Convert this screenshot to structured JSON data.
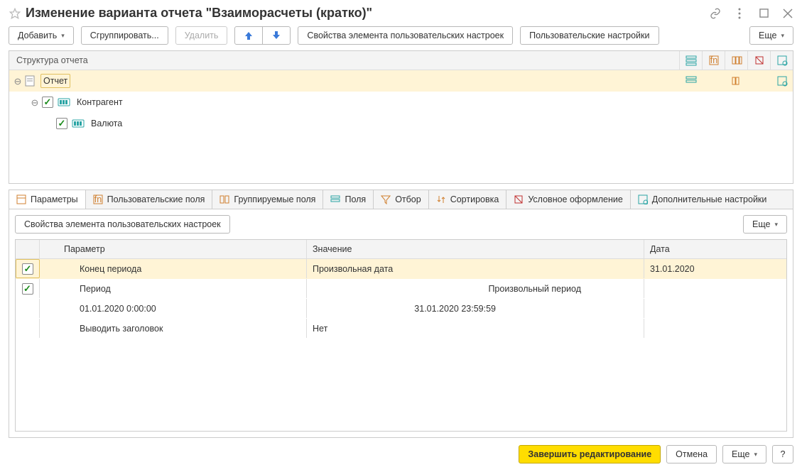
{
  "title": "Изменение варианта отчета \"Взаиморасчеты (кратко)\"",
  "toolbar": {
    "add": "Добавить",
    "group": "Сгруппировать...",
    "delete": "Удалить",
    "user_settings_props": "Свойства элемента пользовательских настроек",
    "user_settings": "Пользовательские настройки",
    "more": "Еще"
  },
  "structure": {
    "header": "Структура отчета",
    "root": "Отчет",
    "level1": "Контрагент",
    "level2": "Валюта"
  },
  "tabs": {
    "parameters": "Параметры",
    "user_fields": "Пользовательские поля",
    "group_fields": "Группируемые поля",
    "fields": "Поля",
    "filter": "Отбор",
    "sort": "Сортировка",
    "conditional": "Условное оформление",
    "extra": "Дополнительные настройки"
  },
  "param_toolbar": {
    "user_settings_props": "Свойства элемента пользовательских настроек",
    "more": "Еще"
  },
  "grid": {
    "col_param": "Параметр",
    "col_value": "Значение",
    "col_date": "Дата",
    "rows": [
      {
        "checked": true,
        "param": "Конец периода",
        "value": "Произвольная дата",
        "date": "31.01.2020"
      },
      {
        "checked": true,
        "param": "Период",
        "value_center": "Произвольный период",
        "date": ""
      },
      {
        "checked": null,
        "param": "01.01.2020 0:00:00",
        "value_right": "31.01.2020 23:59:59",
        "date": ""
      },
      {
        "checked": null,
        "param": "Выводить заголовок",
        "value": "Нет",
        "date": ""
      }
    ]
  },
  "footer": {
    "finish": "Завершить редактирование",
    "cancel": "Отмена",
    "more": "Еще",
    "help": "?"
  }
}
